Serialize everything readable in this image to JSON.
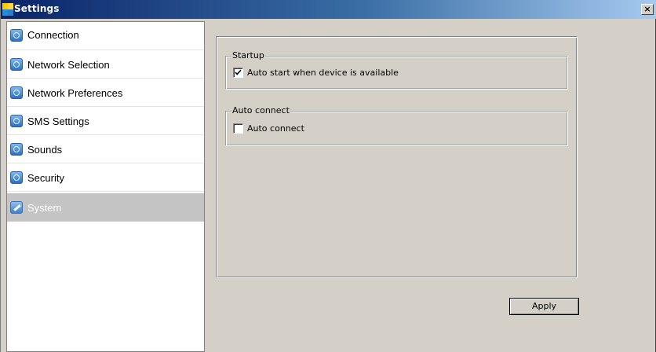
{
  "window": {
    "title": "Settings",
    "close_glyph": "×"
  },
  "sidebar": {
    "items": [
      {
        "label": "Connection",
        "icon": "connection-icon"
      },
      {
        "label": "Network Selection",
        "icon": "network-selection-icon"
      },
      {
        "label": "Network Preferences",
        "icon": "network-preferences-icon"
      },
      {
        "label": "SMS Settings",
        "icon": "sms-icon"
      },
      {
        "label": "Sounds",
        "icon": "sounds-icon"
      },
      {
        "label": "Security",
        "icon": "security-icon"
      },
      {
        "label": "System",
        "icon": "system-icon",
        "selected": true
      }
    ]
  },
  "main": {
    "startup": {
      "legend": "Startup",
      "auto_start": {
        "label": "Auto start when device is available",
        "checked": true
      }
    },
    "auto_connect": {
      "legend": "Auto connect",
      "auto_connect": {
        "label": "Auto connect",
        "checked": false
      }
    },
    "apply_label": "Apply"
  },
  "colors": {
    "titlebar_start": "#0a246a",
    "titlebar_end": "#a6caf0",
    "selected_item_bg": "#c4c4c4",
    "dialog_bg": "#d4d0c8"
  }
}
